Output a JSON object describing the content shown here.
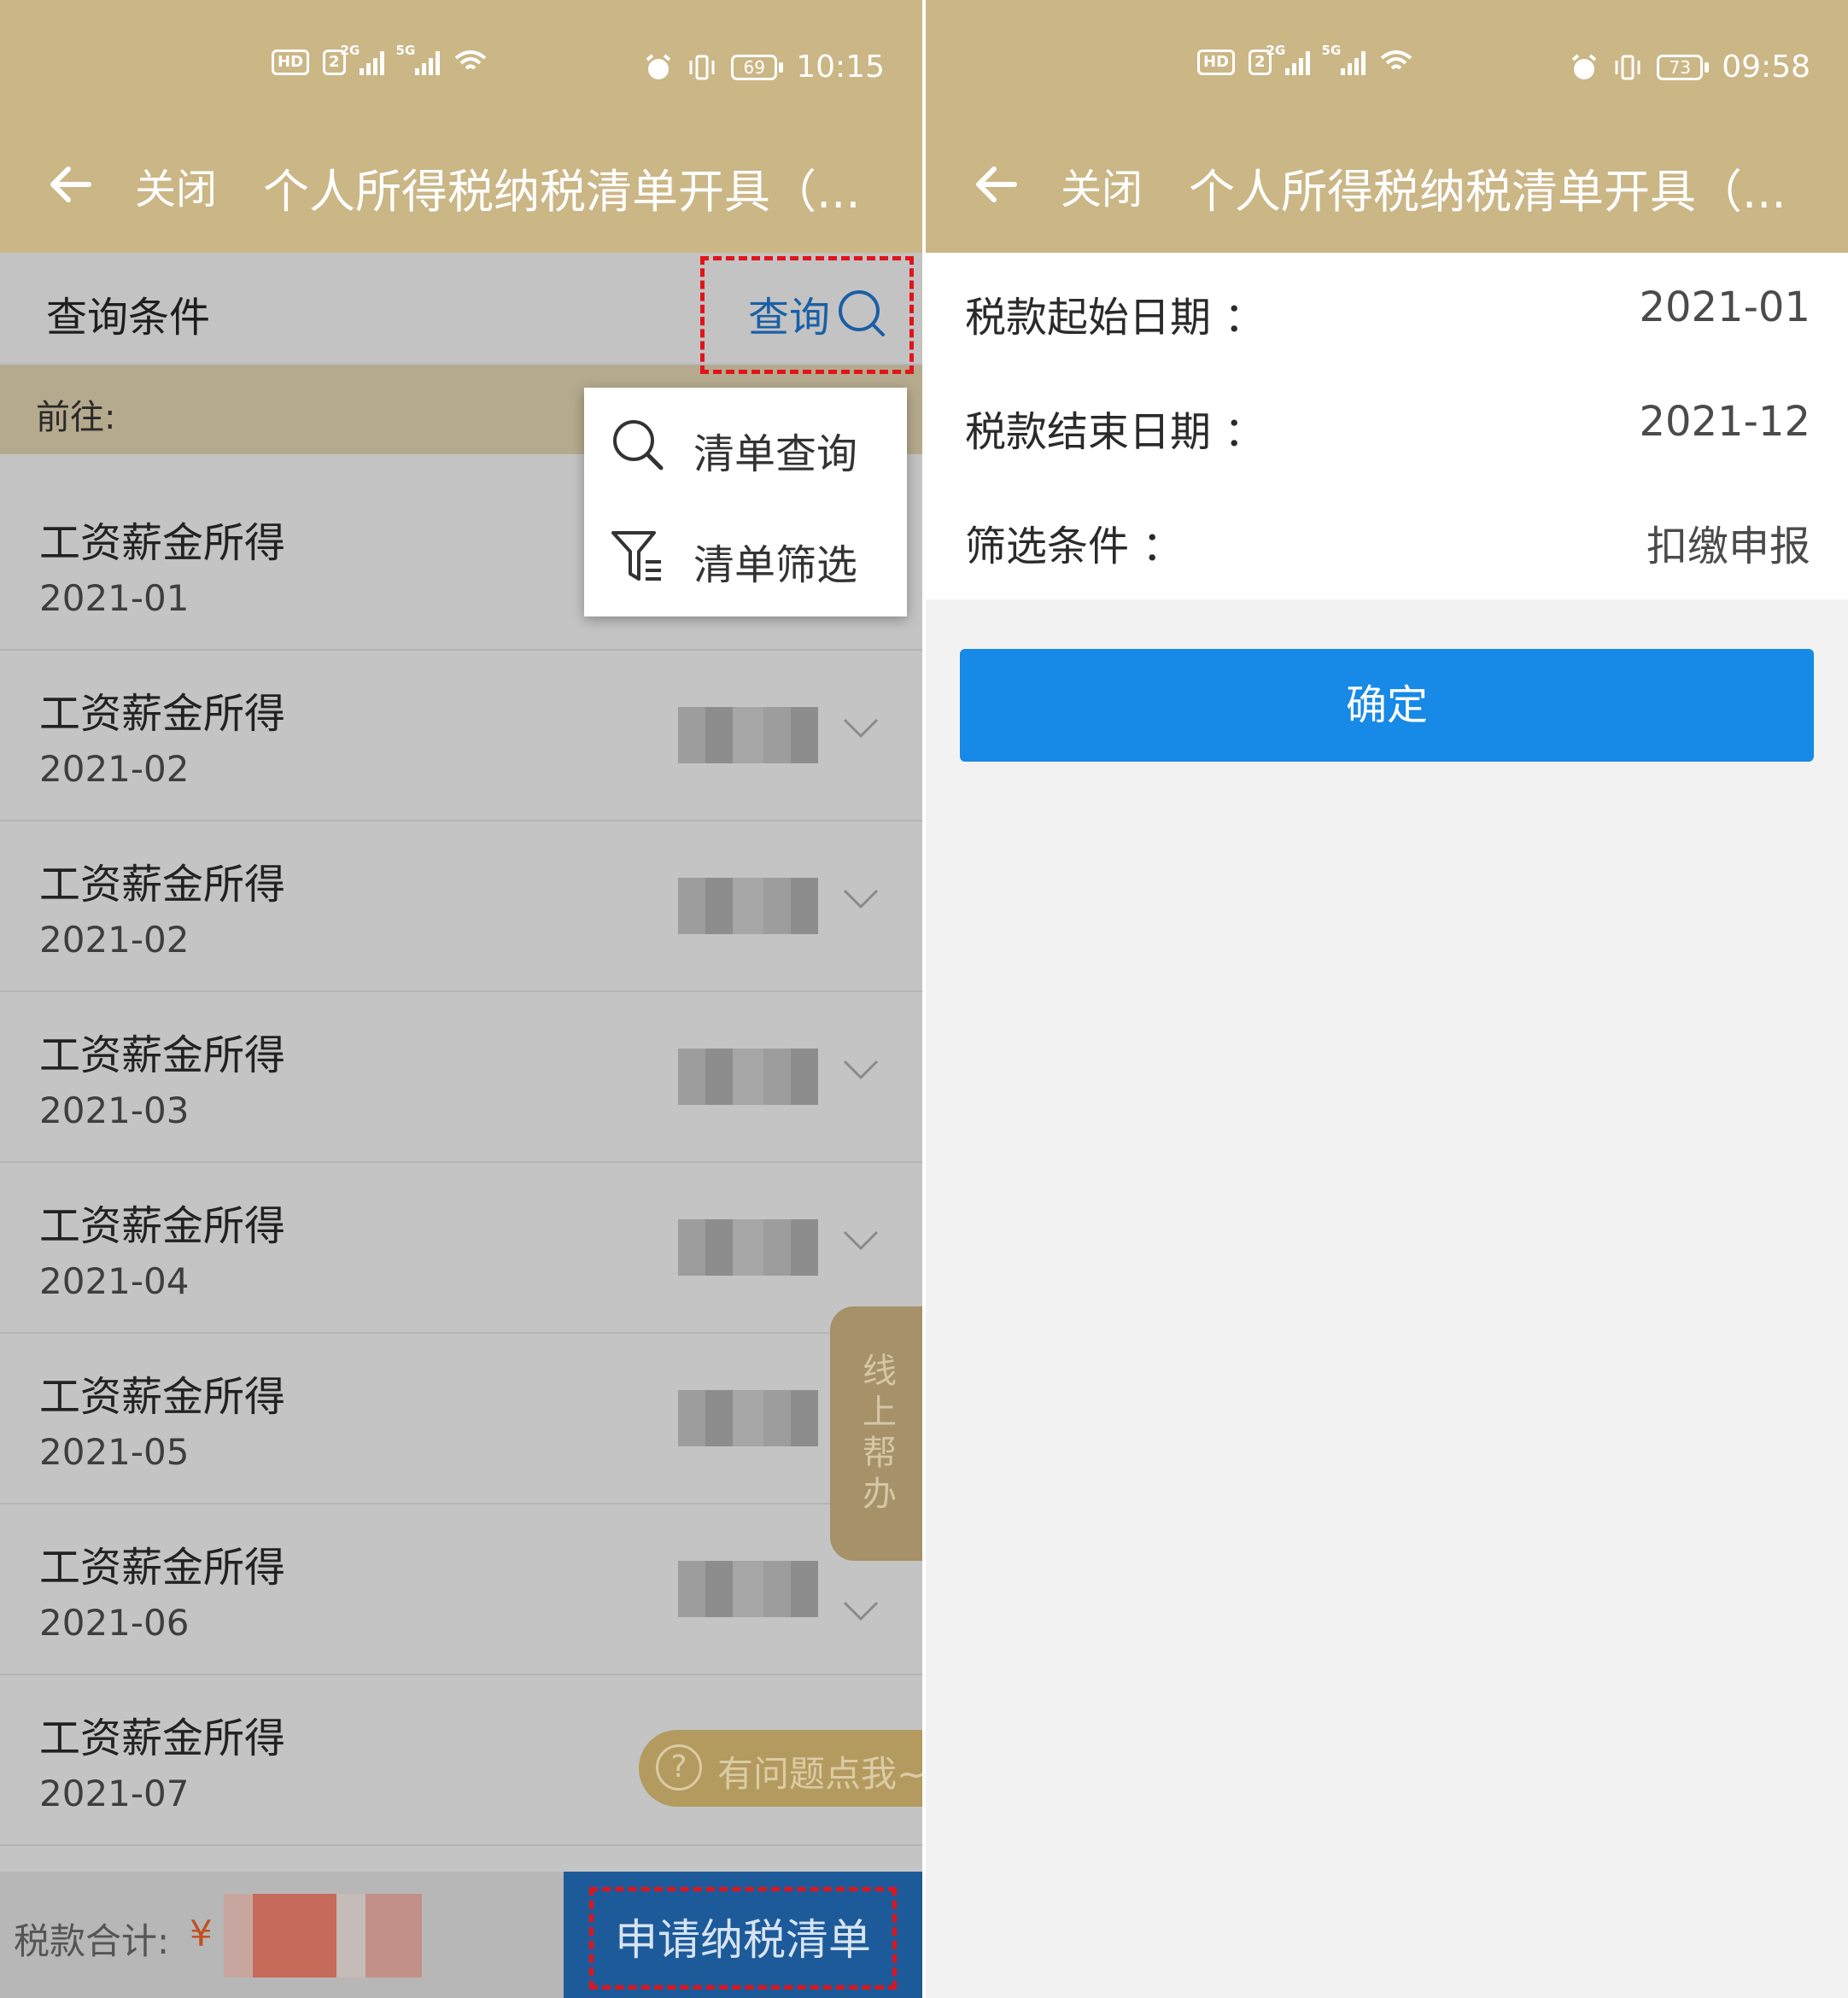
{
  "status_left": {
    "time": "10:15",
    "battery": "69",
    "network_a": "2G",
    "network_b": "5G",
    "sim": "2"
  },
  "status_right": {
    "time": "09:58",
    "battery": "73",
    "network_a": "2G",
    "network_b": "5G",
    "sim": "2"
  },
  "header": {
    "close_label": "关闭",
    "title": "个人所得税纳税清单开具（..."
  },
  "query": {
    "title": "查询条件",
    "button_label": "查询"
  },
  "goto": {
    "label": "前往:"
  },
  "dropdown": {
    "items": [
      {
        "label": "清单查询",
        "icon": "search-icon"
      },
      {
        "label": "清单筛选",
        "icon": "filter-icon"
      }
    ]
  },
  "records": [
    {
      "title": "工资薪金所得",
      "date": "2021-01"
    },
    {
      "title": "工资薪金所得",
      "date": "2021-02"
    },
    {
      "title": "工资薪金所得",
      "date": "2021-02"
    },
    {
      "title": "工资薪金所得",
      "date": "2021-03"
    },
    {
      "title": "工资薪金所得",
      "date": "2021-04"
    },
    {
      "title": "工资薪金所得",
      "date": "2021-05"
    },
    {
      "title": "工资薪金所得",
      "date": "2021-06"
    },
    {
      "title": "工资薪金所得",
      "date": "2021-07"
    }
  ],
  "help": {
    "online_help": "线上帮办",
    "faq": "有问题点我~"
  },
  "footer": {
    "total_label": "税款合计:",
    "currency": "¥",
    "apply_label": "申请纳税清单"
  },
  "filter_form": {
    "start": {
      "label": "税款起始日期",
      "value": "2021-01"
    },
    "end": {
      "label": "税款结束日期",
      "value": "2021-12"
    },
    "condition": {
      "label": "筛选条件",
      "value": "扣缴申报"
    },
    "separator": "：",
    "confirm_label": "确定"
  },
  "colors": {
    "header": "#cbb686",
    "link_blue": "#1a5fa6",
    "confirm_blue": "#1789e6",
    "apply_bg": "#1d5a9a",
    "highlight_red": "#e0141a"
  }
}
